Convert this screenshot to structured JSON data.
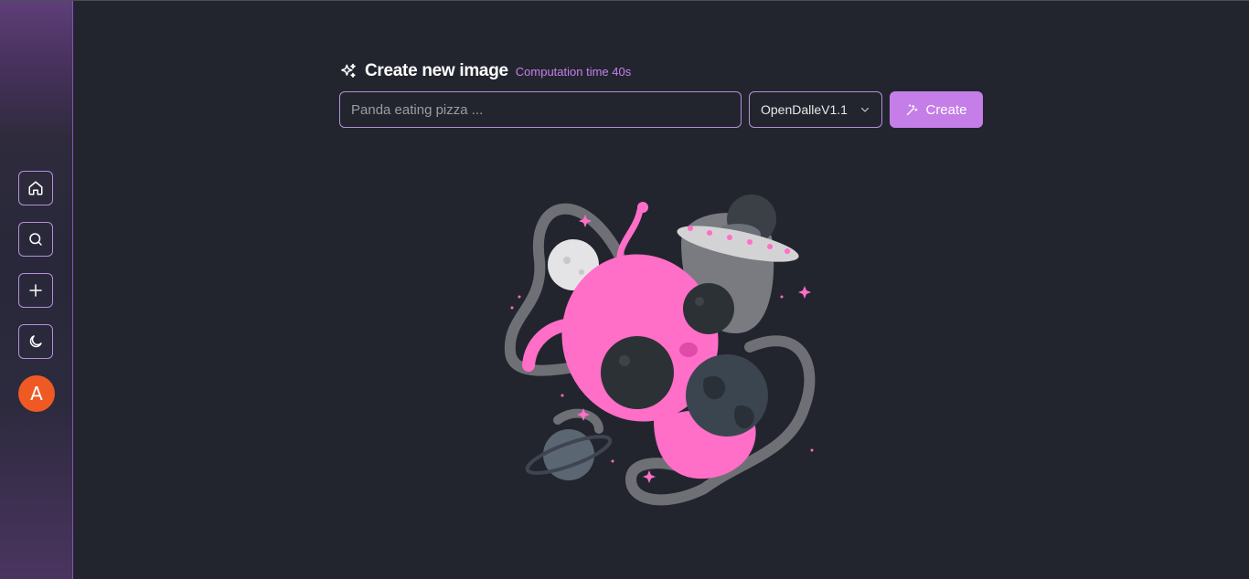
{
  "sidebar": {
    "items": [
      {
        "name": "home",
        "icon": "home-icon"
      },
      {
        "name": "search",
        "icon": "search-icon"
      },
      {
        "name": "add",
        "icon": "plus-icon"
      },
      {
        "name": "theme",
        "icon": "moon-icon"
      }
    ],
    "avatar_letter": "A"
  },
  "header": {
    "icon": "sparkles-icon",
    "title": "Create new image",
    "computation_time": "Computation time 40s"
  },
  "prompt": {
    "placeholder": "Panda eating pizza ...",
    "value": ""
  },
  "model": {
    "selected": "OpenDalleV1.1"
  },
  "create_button": {
    "label": "Create",
    "icon": "magic-wand-icon"
  },
  "illustration": {
    "subject": "alien-astronaut-illustration"
  },
  "colors": {
    "accent": "#c57ee8",
    "background": "#22252e",
    "border": "#b48fd8",
    "avatar": "#ef5a24"
  }
}
